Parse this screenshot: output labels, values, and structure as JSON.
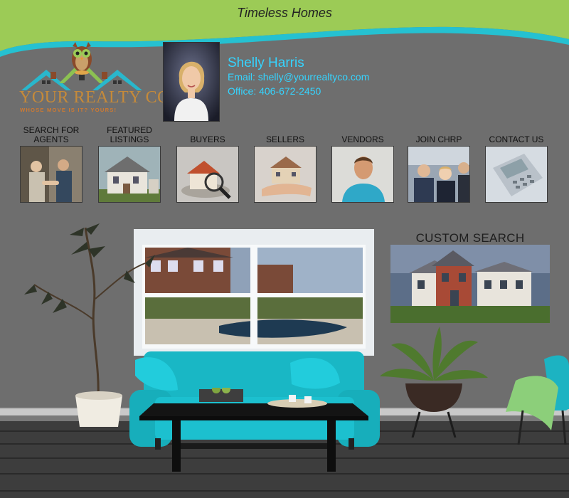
{
  "header": {
    "title": "Timeless Homes"
  },
  "logo": {
    "name": "YOUR REALTY CO",
    "tagline": "WHOSE MOVE IS IT? YOURS!"
  },
  "agent": {
    "name": "Shelly Harris",
    "email": "Email: shelly@yourrealtyco.com",
    "office": "Office: 406-672-2450"
  },
  "nav": [
    {
      "label": "SEARCH FOR AGENTS",
      "icon": "handshake-icon"
    },
    {
      "label": "FEATURED LISTINGS",
      "icon": "house-icon"
    },
    {
      "label": "BUYERS",
      "icon": "magnifier-house-icon"
    },
    {
      "label": "SELLERS",
      "icon": "house-in-hand-icon"
    },
    {
      "label": "VENDORS",
      "icon": "person-icon"
    },
    {
      "label": "JOIN CHRP",
      "icon": "group-icon"
    },
    {
      "label": "CONTACT US",
      "icon": "phone-icon"
    }
  ],
  "custom_search": {
    "label": "CUSTOM SEARCH"
  },
  "colors": {
    "background": "#6e6e6e",
    "header_green": "#9ccb56",
    "header_teal": "#25c1d1",
    "accent_cyan": "#35d4ff",
    "sofa": "#19b7c5"
  }
}
